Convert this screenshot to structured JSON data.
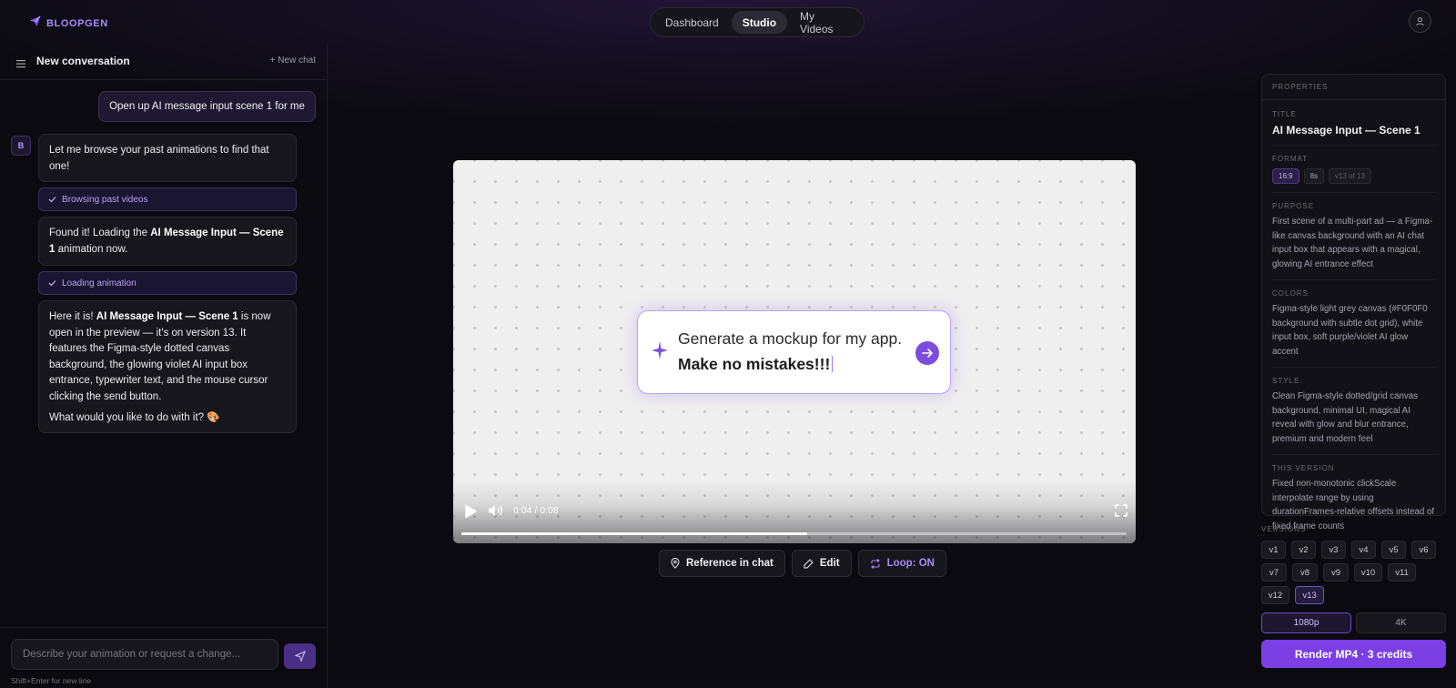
{
  "app": {
    "brand": "BLOOPGEN"
  },
  "nav": {
    "tabs": [
      {
        "label": "Dashboard"
      },
      {
        "label": "Studio"
      },
      {
        "label": "My Videos"
      }
    ]
  },
  "chat": {
    "title": "New conversation",
    "new_chat": "+ New chat",
    "user_message": "Open up AI message input scene 1 for me",
    "bot_avatar": "B",
    "bot_message_1": "Let me browse your past animations to find that one!",
    "status_1": "Browsing past videos",
    "bot_message_2_pre": "Found it! Loading the ",
    "bot_message_2_bold": "AI Message Input — Scene 1",
    "bot_message_2_post": " animation now.",
    "status_2": "Loading animation",
    "bot_message_3_pre": "Here it is! ",
    "bot_message_3_bold": "AI Message Input — Scene 1",
    "bot_message_3_post": " is now open in the preview — it's on version 13. It features the Figma-style dotted canvas background, the glowing violet AI input box entrance, typewriter text, and the mouse cursor clicking the send button.",
    "bot_message_3_question": "What would you like to do with it? 🎨",
    "input_placeholder": "Describe your animation or request a change...",
    "hint": "Shift+Enter for new line"
  },
  "preview": {
    "line1": "Generate a mockup for my app.",
    "line2": "Make no mistakes!!!",
    "time": "0:04 / 0:08",
    "progress": 0.52
  },
  "actions": {
    "reference": "Reference in chat",
    "edit": "Edit",
    "loop": "Loop: ON"
  },
  "properties": {
    "header": "PROPERTIES",
    "title_label": "TITLE",
    "title": "AI Message Input — Scene 1",
    "format_label": "FORMAT",
    "format_chips": [
      "16:9",
      "8s",
      "v13 of 13"
    ],
    "purpose_label": "PURPOSE",
    "purpose": "First scene of a multi-part ad — a Figma-like canvas background with an AI chat input box that appears with a magical, glowing AI entrance effect",
    "colors_label": "COLORS",
    "colors": "Figma-style light grey canvas (#F0F0F0 background with subtle dot grid), white input box, soft purple/violet AI glow accent",
    "style_label": "STYLE",
    "style": "Clean Figma-style dotted/grid canvas background, minimal UI, magical AI reveal with glow and blur entrance, premium and modern feel",
    "version_label": "THIS VERSION",
    "version": "Fixed non-monotonic clickScale interpolate range by using durationFrames-relative offsets instead of fixed frame counts"
  },
  "versions": {
    "label": "VERSIONS",
    "items": [
      "v1",
      "v2",
      "v3",
      "v4",
      "v5",
      "v6",
      "v7",
      "v8",
      "v9",
      "v10",
      "v11",
      "v12",
      "v13"
    ],
    "selected": "v13"
  },
  "resolution": {
    "options": [
      "1080p",
      "4K"
    ],
    "selected": "1080p"
  },
  "render": {
    "label": "Render MP4 · 3 credits"
  },
  "colors": {
    "accent": "#7b3fe4",
    "accent_light": "#a78bfa",
    "background": "#0b0a10",
    "canvas": "#efefef"
  }
}
